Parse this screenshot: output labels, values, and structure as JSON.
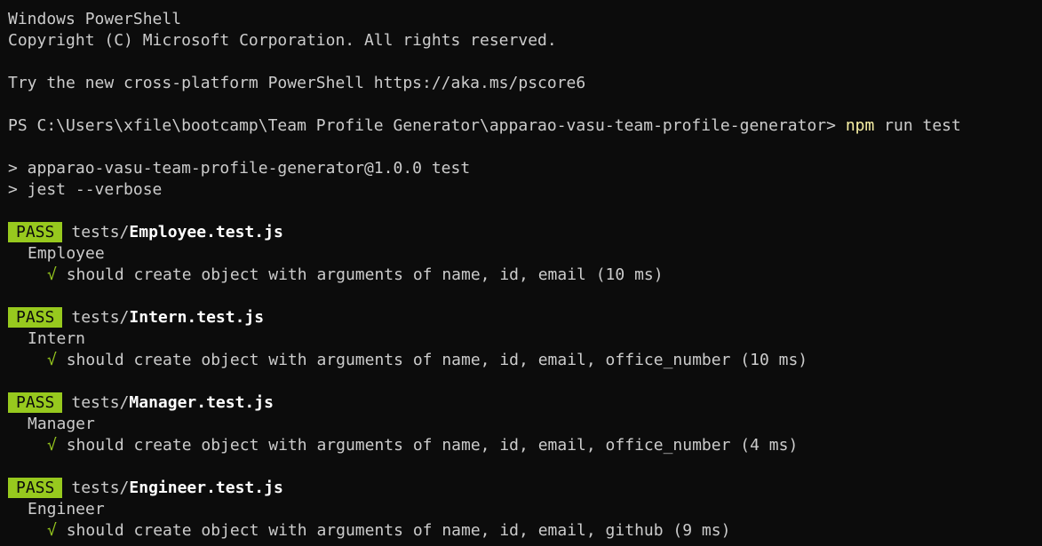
{
  "header": {
    "line1": "Windows PowerShell",
    "line2": "Copyright (C) Microsoft Corporation. All rights reserved.",
    "line3": "Try the new cross-platform PowerShell https://aka.ms/pscore6"
  },
  "prompt": {
    "path": "PS C:\\Users\\xfile\\bootcamp\\Team Profile Generator\\apparao-vasu-team-profile-generator> ",
    "command_npm": "npm",
    "command_rest": " run test"
  },
  "script": {
    "line1": "> apparao-vasu-team-profile-generator@1.0.0 test",
    "line2": "> jest --verbose"
  },
  "colors": {
    "background": "#0c0c0c",
    "text": "#cccccc",
    "pass_badge": "#97c91e",
    "command": "#f9f1a5"
  },
  "tests": [
    {
      "status": "PASS",
      "dir": "tests/",
      "file": "Employee.test.js",
      "suite": "Employee",
      "check": "√",
      "case": "should create object with arguments of name, id, email (10 ms)"
    },
    {
      "status": "PASS",
      "dir": "tests/",
      "file": "Intern.test.js",
      "suite": "Intern",
      "check": "√",
      "case": "should create object with arguments of name, id, email, office_number (10 ms)"
    },
    {
      "status": "PASS",
      "dir": "tests/",
      "file": "Manager.test.js",
      "suite": "Manager",
      "check": "√",
      "case": "should create object with arguments of name, id, email, office_number (4 ms)"
    },
    {
      "status": "PASS",
      "dir": "tests/",
      "file": "Engineer.test.js",
      "suite": "Engineer",
      "check": "√",
      "case": "should create object with arguments of name, id, email, github (9 ms)"
    }
  ]
}
